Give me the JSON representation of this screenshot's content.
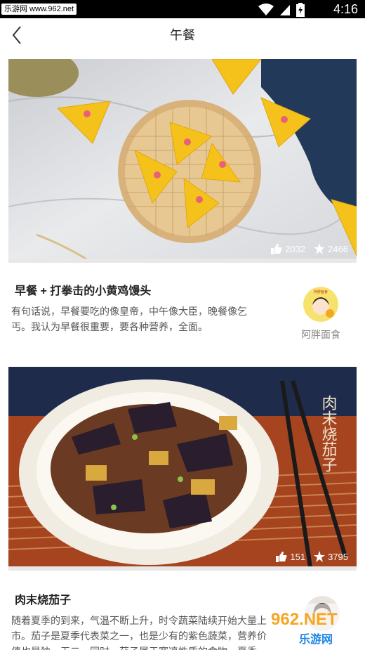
{
  "status_bar": {
    "watermark": "乐游网 www.962.net",
    "time": "4:16"
  },
  "header": {
    "title": "午餐"
  },
  "recipes": [
    {
      "title": "早餐 + 打拳击的小黄鸡馒头",
      "description": "有句话说，早餐要吃的像皇帝，中午像大臣，晚餐像乞丐。我认为早餐很重要，要各种营养，全面。",
      "likes": "2032",
      "favorites": "2466",
      "author": "阿胖面食",
      "author_badge": "阿胖面食"
    },
    {
      "title": "肉末烧茄子",
      "description": "随着夏季的到来，气温不断上升，时令蔬菜陆续开始大量上市。茄子是夏季代表菜之一，也是少有的紫色蔬菜，营养价值也是独一无二。同时，茄子属于寒凉性质的食物。夏季",
      "likes": "151",
      "favorites": "3795",
      "image_text": "肉末烧茄子"
    }
  ],
  "bottom_watermark": {
    "logo": "962.NET",
    "site": "乐游网"
  },
  "colors": {
    "status_bar": "#000000",
    "background": "#ffffff",
    "title_text": "#222222",
    "desc_text": "#555555",
    "author_text": "#888888",
    "watermark_orange": "#f5a623",
    "watermark_blue": "#1e88e5"
  }
}
